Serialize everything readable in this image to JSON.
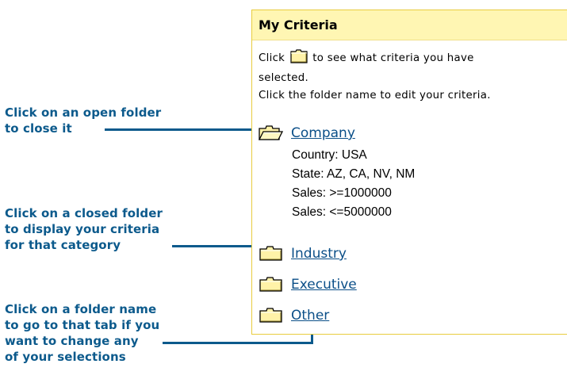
{
  "callouts": {
    "open_folder": [
      "Click on an open folder",
      "to close it"
    ],
    "closed_folder": [
      "Click on a closed folder",
      "to display your criteria",
      "for that category"
    ],
    "folder_name": [
      "Click on a folder name",
      "to go to that tab if you",
      "want to change any",
      "of your selections"
    ]
  },
  "panel": {
    "title": "My Criteria",
    "instruction_before_icon": "Click",
    "instruction_after_icon": "to see what criteria you have",
    "instruction_line2": "selected.",
    "instruction_line3": "Click the folder name to edit your criteria.",
    "folders": [
      {
        "label": "Company",
        "state": "open",
        "icon": "open-folder-icon",
        "criteria": [
          "Country: USA",
          "State: AZ, CA, NV, NM",
          "Sales: >=1000000",
          "Sales: <=5000000"
        ]
      },
      {
        "label": "Industry",
        "state": "closed",
        "icon": "closed-folder-icon"
      },
      {
        "label": "Executive",
        "state": "closed",
        "icon": "closed-folder-icon"
      },
      {
        "label": "Other",
        "state": "closed",
        "icon": "closed-folder-icon"
      }
    ]
  },
  "colors": {
    "callout_text": "#0c5a8c",
    "link": "#0b4f88",
    "header_bg": "#fff6b3",
    "panel_border": "#e8cc3e",
    "folder_fill": "#fff2a8"
  }
}
